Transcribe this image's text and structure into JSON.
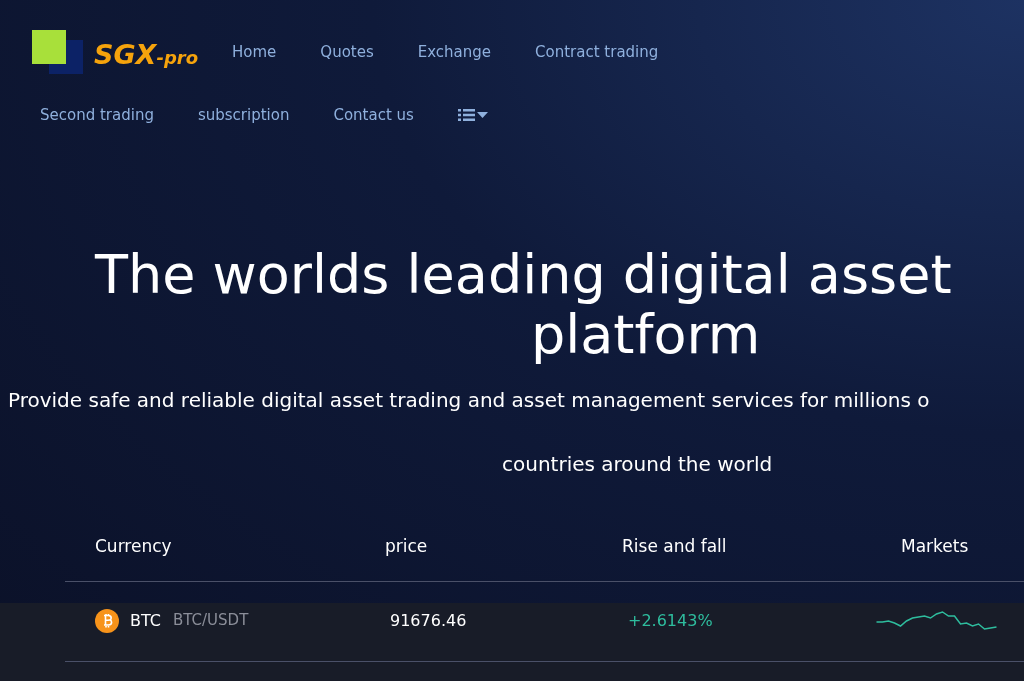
{
  "logo": {
    "main": "SGX",
    "suffix": "-pro"
  },
  "nav": {
    "row_1": [
      "Home",
      "Quotes",
      "Exchange",
      "Contract trading"
    ],
    "row_2": [
      "Second trading",
      "subscription",
      "Contact us"
    ]
  },
  "hero": {
    "title_line_1": "The worlds leading digital asset",
    "title_line_2": "platform",
    "subtitle_line_1": "Provide safe and reliable digital asset trading and asset management services for millions o",
    "subtitle_line_2": "countries around the world"
  },
  "table": {
    "columns": [
      "Currency",
      "price",
      "Rise and fall",
      "Markets"
    ],
    "rows": [
      {
        "symbol": "BTC",
        "pair": "BTC/USDT",
        "price": "91676.46",
        "change": "+2.6143%",
        "color": "#2ebd9e"
      }
    ]
  }
}
